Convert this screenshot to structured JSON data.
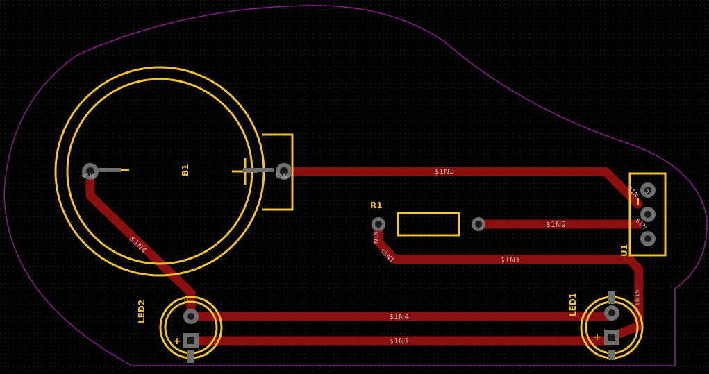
{
  "colors": {
    "background": "#000000",
    "grid_dot": "#2a2a2a",
    "board_outline": "#8e1a8e",
    "copper_track": "#8b0f0f",
    "silkscreen": "#f2c12e",
    "pad": "#6e6e6e",
    "pad_hole": "#1a1a1a",
    "net_label": "#b9a7a7"
  },
  "components": {
    "b1": {
      "ref": "B1"
    },
    "r1": {
      "ref": "R1"
    },
    "u1": {
      "ref": "U1",
      "pin_label": "3"
    },
    "led1": {
      "ref": "LED1",
      "polarity": "+"
    },
    "led2": {
      "ref": "LED2",
      "polarity": "+"
    }
  },
  "nets": {
    "n1": "$1N1",
    "n2": "$1N2",
    "n3": "$1N3",
    "n4": "$1N4"
  },
  "pad_labels": {
    "b1_left": "$1N",
    "b1_right": "$1N",
    "u1_top": "$1N",
    "u1_mid": "$1N",
    "r1_left": "$1N",
    "led2_top": "4",
    "led1_right": "$1N1"
  }
}
